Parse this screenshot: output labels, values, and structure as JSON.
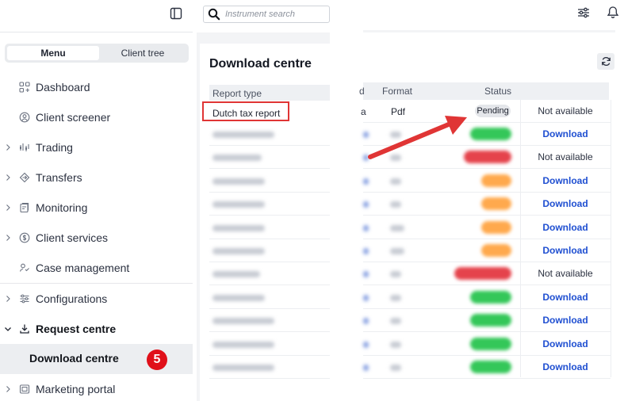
{
  "sidebar": {
    "segments": {
      "menu": "Menu",
      "client_tree": "Client tree"
    },
    "items": [
      {
        "label": "Dashboard",
        "icon": "grid-icon",
        "has_chevron": false
      },
      {
        "label": "Client screener",
        "icon": "user-circle-icon",
        "has_chevron": false
      },
      {
        "label": "Trading",
        "icon": "trading-icon",
        "has_chevron": true
      },
      {
        "label": "Transfers",
        "icon": "transfer-icon",
        "has_chevron": true
      },
      {
        "label": "Monitoring",
        "icon": "monitoring-icon",
        "has_chevron": true
      },
      {
        "label": "Client services",
        "icon": "dollar-circle-icon",
        "has_chevron": true
      },
      {
        "label": "Case management",
        "icon": "case-icon",
        "has_chevron": false
      },
      {
        "label": "Configurations",
        "icon": "sliders-icon",
        "has_chevron": true
      },
      {
        "label": "Request centre",
        "icon": "download-icon",
        "has_chevron": true,
        "expanded": true
      },
      {
        "label": "Download centre",
        "icon": "",
        "selected": true
      },
      {
        "label": "Marketing portal",
        "icon": "marketing-icon",
        "has_chevron": true
      }
    ],
    "step_badge": "5"
  },
  "header": {
    "search": {
      "placeholder": "Instrument search"
    },
    "icons": [
      "sidebar-toggle-icon",
      "filter-icon",
      "bell-icon"
    ]
  },
  "main": {
    "title": "Download centre",
    "columns": {
      "report_type": "Report type",
      "partial_d": "d",
      "format": "Format",
      "status": "Status"
    },
    "first_row": {
      "report_type": "Dutch tax report",
      "partial_a": "a",
      "format": "Pdf",
      "status": "Pending",
      "action": "Not available"
    },
    "blurred_rows": [
      {
        "status_color": "#34c759",
        "action": "Download"
      },
      {
        "status_color": "#e5434c",
        "action": "Not available"
      },
      {
        "status_color": "#ffa94d",
        "action": "Download"
      },
      {
        "status_color": "#ffa94d",
        "action": "Download"
      },
      {
        "status_color": "#ffa94d",
        "action": "Download"
      },
      {
        "status_color": "#ffa94d",
        "action": "Download"
      },
      {
        "status_color": "#e5434c",
        "action": "Not available"
      },
      {
        "status_color": "#34c759",
        "action": "Download"
      },
      {
        "status_color": "#34c759",
        "action": "Download"
      },
      {
        "status_color": "#34c759",
        "action": "Download"
      },
      {
        "status_color": "#34c759",
        "action": "Download"
      }
    ]
  },
  "colors": {
    "accent_link": "#1f4fd1",
    "highlight": "#e03535",
    "badge": "#e0101a"
  }
}
